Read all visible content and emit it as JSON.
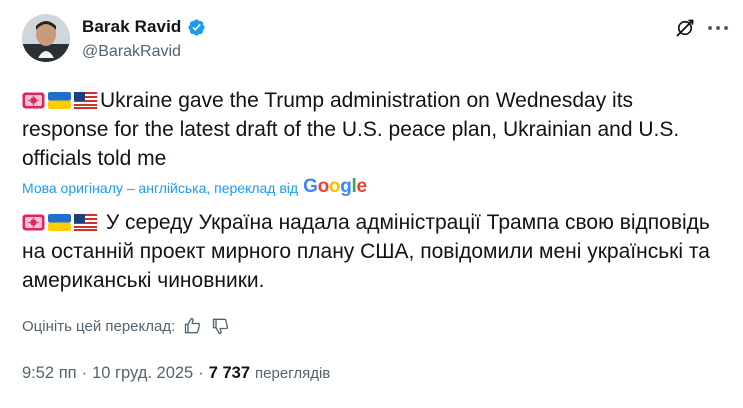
{
  "author": {
    "display_name": "Barak Ravid",
    "handle": "@BarakRavid",
    "verified": true
  },
  "header_icons": [
    "grok-icon",
    "more-options-icon"
  ],
  "tweet": {
    "original_text": "Ukraine gave the Trump administration on Wednesday its response for the latest draft of the U.S. peace plan, Ukrainian and U.S. officials told me",
    "translation_note": "Мова оригіналу – англійська, переклад від",
    "translation_provider": "Google",
    "translated_text": "У середу Україна надала адміністрації Трампа свою відповідь на останній проект мирного плану США, повідомили мені українські та американські чиновники.",
    "emoji_prefix": [
      "police-light-emoji",
      "ukraine-flag-emoji",
      "us-flag-emoji"
    ]
  },
  "rate_translation": {
    "label": "Оцініть цей переклад:"
  },
  "meta": {
    "time": "9:52 пп",
    "date": "10 груд. 2025",
    "separator": "·",
    "views_count": "7 737",
    "views_label": "переглядів"
  },
  "colors": {
    "text": "#0f1419",
    "secondary": "#536471",
    "link": "#1d9bf0",
    "verified": "#1d9bf0"
  }
}
